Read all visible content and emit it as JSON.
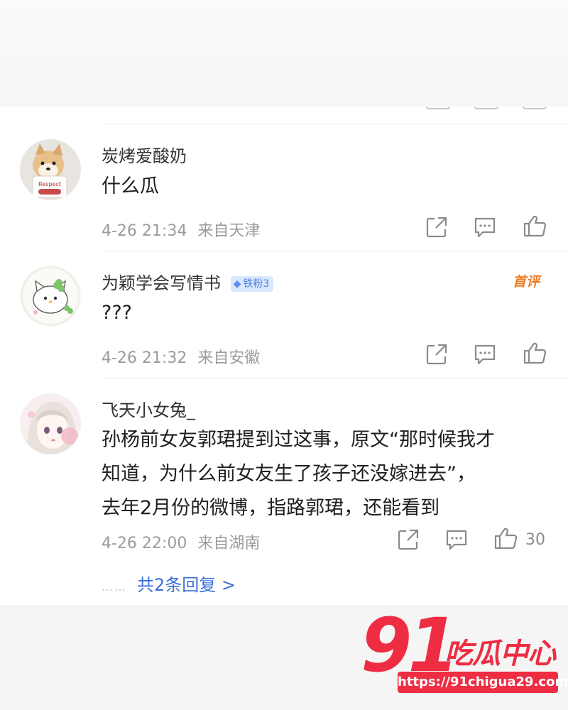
{
  "comments": [
    {
      "name": "炭烤爱酸奶",
      "text": "什么瓜",
      "date": "4-26 21:34",
      "location": "来自天津",
      "avatar_icon": "shiba-dog-avatar"
    },
    {
      "name": "为颖学会写情书",
      "badge": "铁粉3",
      "tag": "首评",
      "text": "???",
      "date": "4-26 21:32",
      "location": "来自安徽",
      "avatar_icon": "hello-kitty-avatar"
    },
    {
      "name": "飞天小女兔_",
      "text_lines": [
        "孙杨前女友郭珺提到过这事，原文“那时候我才",
        "知道，为什么前女友生了孩子还没嫁进去”，",
        "去年2月份的微博，指路郭珺，还能看到"
      ],
      "date": "4-26 22:00",
      "location": "来自湖南",
      "likes": "30",
      "avatar_icon": "anime-girl-avatar",
      "replies_label": "共2条回复 >",
      "replies_dots": "……"
    }
  ],
  "watermark": {
    "number": "91",
    "name": "吃瓜中心",
    "url": "https://91chigua29.com"
  },
  "colors": {
    "accent_blue": "#3a6fd8",
    "meta_gray": "#9b9b9b",
    "watermark_red": "#ee2d43",
    "first_comment_orange": "#f07b22"
  }
}
